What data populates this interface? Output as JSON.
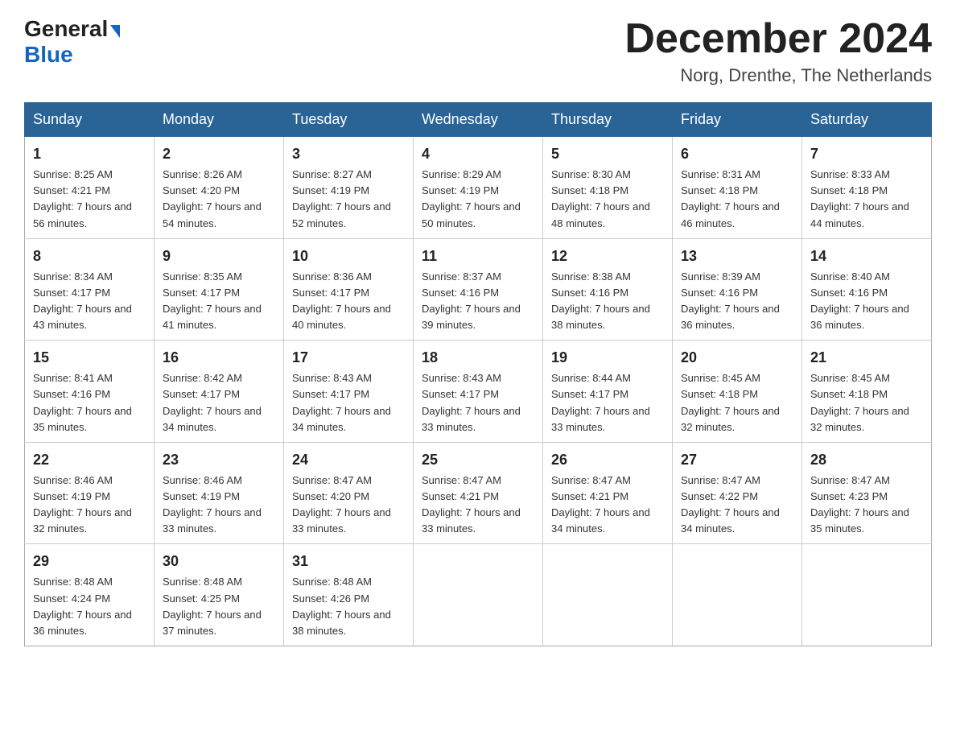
{
  "header": {
    "logo_general": "General",
    "logo_blue": "Blue",
    "month_title": "December 2024",
    "location": "Norg, Drenthe, The Netherlands"
  },
  "weekdays": [
    "Sunday",
    "Monday",
    "Tuesday",
    "Wednesday",
    "Thursday",
    "Friday",
    "Saturday"
  ],
  "weeks": [
    [
      {
        "day": "1",
        "sunrise": "8:25 AM",
        "sunset": "4:21 PM",
        "daylight": "7 hours and 56 minutes."
      },
      {
        "day": "2",
        "sunrise": "8:26 AM",
        "sunset": "4:20 PM",
        "daylight": "7 hours and 54 minutes."
      },
      {
        "day": "3",
        "sunrise": "8:27 AM",
        "sunset": "4:19 PM",
        "daylight": "7 hours and 52 minutes."
      },
      {
        "day": "4",
        "sunrise": "8:29 AM",
        "sunset": "4:19 PM",
        "daylight": "7 hours and 50 minutes."
      },
      {
        "day": "5",
        "sunrise": "8:30 AM",
        "sunset": "4:18 PM",
        "daylight": "7 hours and 48 minutes."
      },
      {
        "day": "6",
        "sunrise": "8:31 AM",
        "sunset": "4:18 PM",
        "daylight": "7 hours and 46 minutes."
      },
      {
        "day": "7",
        "sunrise": "8:33 AM",
        "sunset": "4:18 PM",
        "daylight": "7 hours and 44 minutes."
      }
    ],
    [
      {
        "day": "8",
        "sunrise": "8:34 AM",
        "sunset": "4:17 PM",
        "daylight": "7 hours and 43 minutes."
      },
      {
        "day": "9",
        "sunrise": "8:35 AM",
        "sunset": "4:17 PM",
        "daylight": "7 hours and 41 minutes."
      },
      {
        "day": "10",
        "sunrise": "8:36 AM",
        "sunset": "4:17 PM",
        "daylight": "7 hours and 40 minutes."
      },
      {
        "day": "11",
        "sunrise": "8:37 AM",
        "sunset": "4:16 PM",
        "daylight": "7 hours and 39 minutes."
      },
      {
        "day": "12",
        "sunrise": "8:38 AM",
        "sunset": "4:16 PM",
        "daylight": "7 hours and 38 minutes."
      },
      {
        "day": "13",
        "sunrise": "8:39 AM",
        "sunset": "4:16 PM",
        "daylight": "7 hours and 36 minutes."
      },
      {
        "day": "14",
        "sunrise": "8:40 AM",
        "sunset": "4:16 PM",
        "daylight": "7 hours and 36 minutes."
      }
    ],
    [
      {
        "day": "15",
        "sunrise": "8:41 AM",
        "sunset": "4:16 PM",
        "daylight": "7 hours and 35 minutes."
      },
      {
        "day": "16",
        "sunrise": "8:42 AM",
        "sunset": "4:17 PM",
        "daylight": "7 hours and 34 minutes."
      },
      {
        "day": "17",
        "sunrise": "8:43 AM",
        "sunset": "4:17 PM",
        "daylight": "7 hours and 34 minutes."
      },
      {
        "day": "18",
        "sunrise": "8:43 AM",
        "sunset": "4:17 PM",
        "daylight": "7 hours and 33 minutes."
      },
      {
        "day": "19",
        "sunrise": "8:44 AM",
        "sunset": "4:17 PM",
        "daylight": "7 hours and 33 minutes."
      },
      {
        "day": "20",
        "sunrise": "8:45 AM",
        "sunset": "4:18 PM",
        "daylight": "7 hours and 32 minutes."
      },
      {
        "day": "21",
        "sunrise": "8:45 AM",
        "sunset": "4:18 PM",
        "daylight": "7 hours and 32 minutes."
      }
    ],
    [
      {
        "day": "22",
        "sunrise": "8:46 AM",
        "sunset": "4:19 PM",
        "daylight": "7 hours and 32 minutes."
      },
      {
        "day": "23",
        "sunrise": "8:46 AM",
        "sunset": "4:19 PM",
        "daylight": "7 hours and 33 minutes."
      },
      {
        "day": "24",
        "sunrise": "8:47 AM",
        "sunset": "4:20 PM",
        "daylight": "7 hours and 33 minutes."
      },
      {
        "day": "25",
        "sunrise": "8:47 AM",
        "sunset": "4:21 PM",
        "daylight": "7 hours and 33 minutes."
      },
      {
        "day": "26",
        "sunrise": "8:47 AM",
        "sunset": "4:21 PM",
        "daylight": "7 hours and 34 minutes."
      },
      {
        "day": "27",
        "sunrise": "8:47 AM",
        "sunset": "4:22 PM",
        "daylight": "7 hours and 34 minutes."
      },
      {
        "day": "28",
        "sunrise": "8:47 AM",
        "sunset": "4:23 PM",
        "daylight": "7 hours and 35 minutes."
      }
    ],
    [
      {
        "day": "29",
        "sunrise": "8:48 AM",
        "sunset": "4:24 PM",
        "daylight": "7 hours and 36 minutes."
      },
      {
        "day": "30",
        "sunrise": "8:48 AM",
        "sunset": "4:25 PM",
        "daylight": "7 hours and 37 minutes."
      },
      {
        "day": "31",
        "sunrise": "8:48 AM",
        "sunset": "4:26 PM",
        "daylight": "7 hours and 38 minutes."
      },
      null,
      null,
      null,
      null
    ]
  ]
}
